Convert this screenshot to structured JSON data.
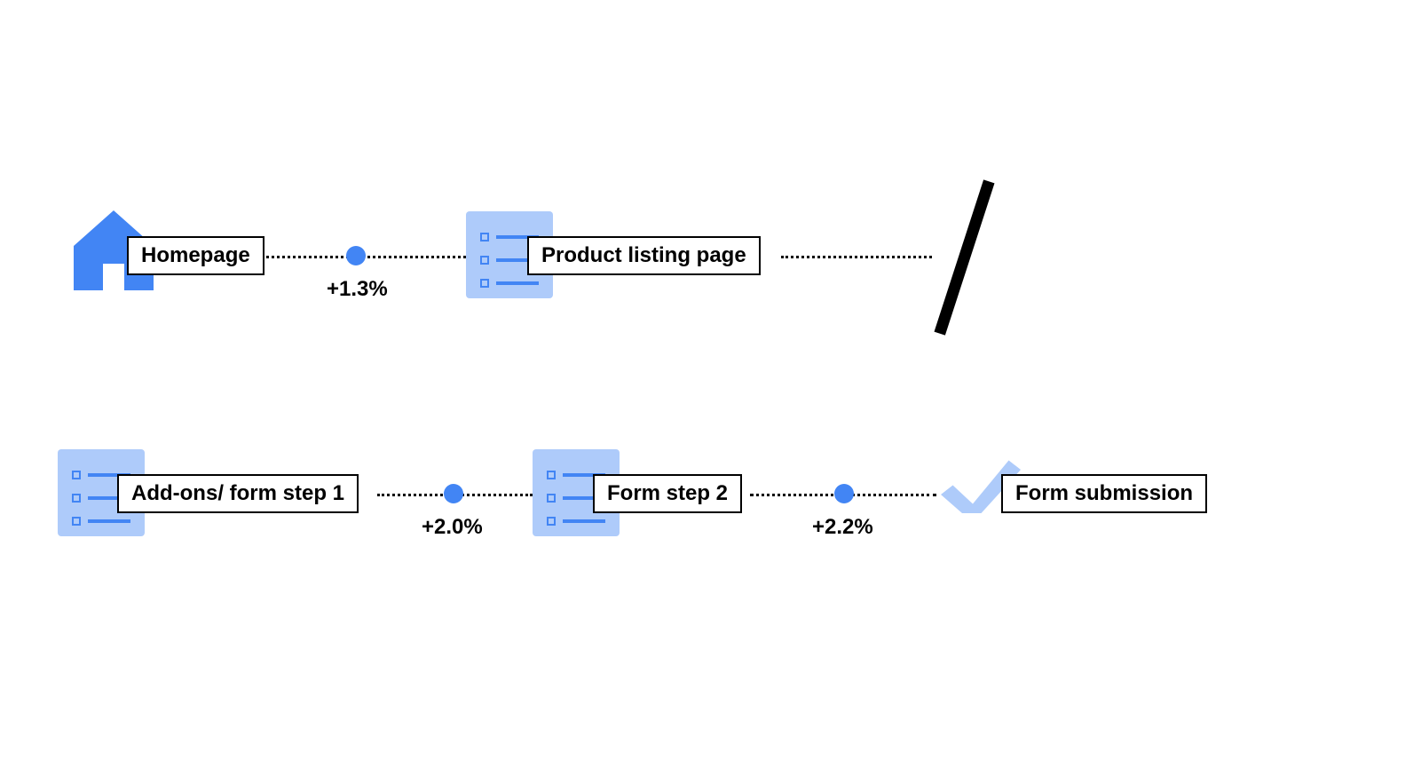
{
  "flow": {
    "row1": {
      "step1": {
        "label": "Homepage",
        "icon": "home"
      },
      "metric1": "+1.3%",
      "step2": {
        "label": "Product listing page",
        "icon": "list"
      }
    },
    "row2": {
      "step1": {
        "label": "Add-ons/ form step 1",
        "icon": "list"
      },
      "metric1": "+2.0%",
      "step2": {
        "label": "Form step 2",
        "icon": "list"
      },
      "metric2": "+2.2%",
      "step3": {
        "label": "Form submission",
        "icon": "check"
      }
    }
  },
  "colors": {
    "accent": "#4285f4",
    "accent_light": "#aecbfa",
    "text": "#000000"
  }
}
